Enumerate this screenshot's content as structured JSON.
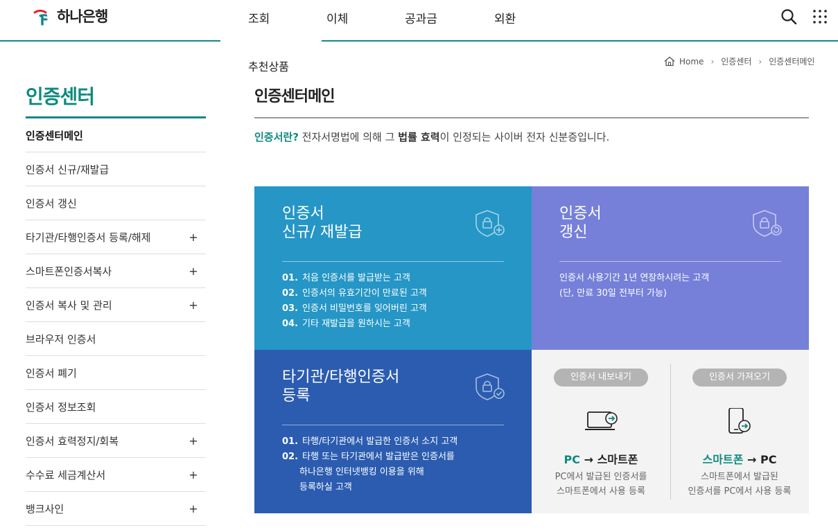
{
  "header": {
    "logo_text": "하나은행",
    "nav": [
      {
        "label": "조회"
      },
      {
        "label": "이체"
      },
      {
        "label": "공과금"
      },
      {
        "label": "외환"
      }
    ]
  },
  "subnav": {
    "label": "추천상품"
  },
  "breadcrumb": [
    "Home",
    "인증센터",
    "인증센터메인"
  ],
  "sidebar": {
    "title": "인증센터",
    "items": [
      {
        "label": "인증센터메인",
        "expand": ""
      },
      {
        "label": "인증서 신규/재발급",
        "expand": ""
      },
      {
        "label": "인증서 갱신",
        "expand": ""
      },
      {
        "label": "타기관/타행인증서 등록/해제",
        "expand": "+"
      },
      {
        "label": "스마트폰인증서복사",
        "expand": "+"
      },
      {
        "label": "인증서 복사 및 관리",
        "expand": "+"
      },
      {
        "label": "브라우저 인증서",
        "expand": ""
      },
      {
        "label": "인증서 폐기",
        "expand": ""
      },
      {
        "label": "인증서 정보조회",
        "expand": ""
      },
      {
        "label": "인증서 효력정지/회복",
        "expand": "+"
      },
      {
        "label": "수수료 세금계산서",
        "expand": "+"
      },
      {
        "label": "뱅크사인",
        "expand": "+"
      }
    ]
  },
  "main": {
    "title": "인증센터메인",
    "intro": {
      "highlight": "인증서란?",
      "part1": " 전자서명법에 의해 그 ",
      "bold": "법률 효력",
      "part2": "이 인정되는 사이버 전자 신분증입니다."
    },
    "cards": {
      "issue": {
        "title": "인증서\n신규/ 재발급",
        "icon": "shield-lock-plus-icon",
        "items": [
          {
            "num": "01.",
            "text": "처음 인증서를 발급받는 고객"
          },
          {
            "num": "02.",
            "text": "인증서의 유효기간이 만료된 고객"
          },
          {
            "num": "03.",
            "text": "인증서 비밀번호를 잊어버린 고객"
          },
          {
            "num": "04.",
            "text": "기타 재발급을 원하시는 고객"
          }
        ]
      },
      "renew": {
        "title": "인증서\n갱신",
        "icon": "shield-lock-refresh-icon",
        "desc1": "인증서 사용기간 1년 연장하시려는 고객",
        "desc2": "(단, 만료 30일 전부터 가능)"
      },
      "register": {
        "title": "타기관/타행인증서\n등록",
        "icon": "shield-lock-check-icon",
        "items": [
          {
            "num": "01.",
            "text": "타행/타기관에서 발급한 인증서 소지 고객"
          },
          {
            "num": "02.",
            "text": "타행 또는 타기관에서 발급받은 인증서를"
          }
        ],
        "cont1": "하나은행 인터넷뱅킹 이용을 위해",
        "cont2": "등록하실 고객"
      },
      "export": {
        "pill": "인증서 내보내기",
        "icon": "laptop-arrow-icon",
        "from": "PC",
        "arrow": "→",
        "to": "스마트폰",
        "desc1": "PC에서 발급된 인증서를",
        "desc2": "스마트폰에서 사용 등록"
      },
      "import": {
        "pill": "인증서 가져오기",
        "icon": "phone-arrow-icon",
        "from": "스마트폰",
        "arrow": "→",
        "to": "PC",
        "desc1": "스마트폰에서 발급된",
        "desc2": "인증서를 PC에서 사용 등록"
      }
    }
  },
  "colors": {
    "brand": "#11878b",
    "teal_card": "#2596c6",
    "purple_card": "#7680d9",
    "navy_card": "#2b5cb0",
    "gray_card": "#f3f3f3"
  }
}
